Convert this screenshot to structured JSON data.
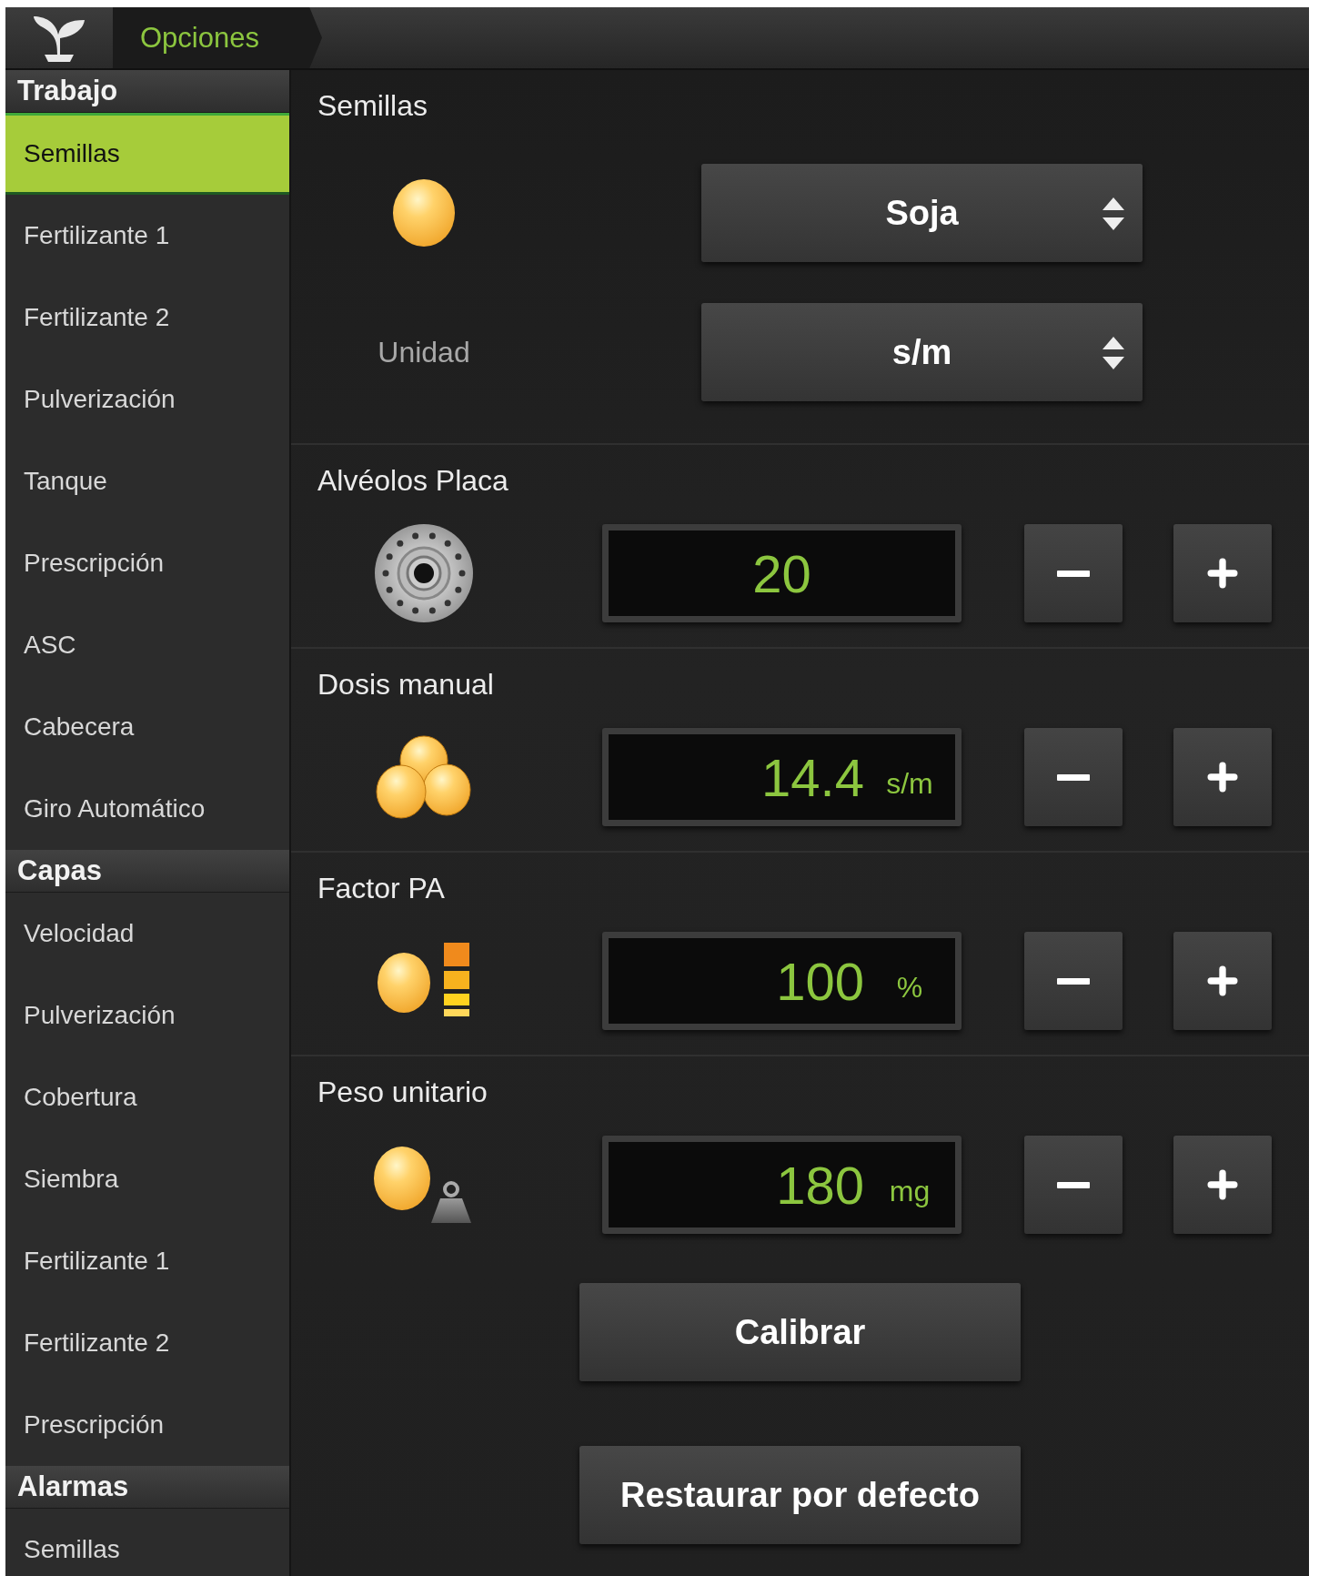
{
  "top_bar": {
    "breadcrumb": "Opciones"
  },
  "sidebar": {
    "groups": [
      {
        "title": "Trabajo",
        "items": [
          {
            "label": "Semillas",
            "selected": true
          },
          {
            "label": "Fertilizante 1",
            "selected": false
          },
          {
            "label": "Fertilizante 2",
            "selected": false
          },
          {
            "label": "Pulverización",
            "selected": false
          },
          {
            "label": "Tanque",
            "selected": false
          },
          {
            "label": "Prescripción",
            "selected": false
          },
          {
            "label": "ASC",
            "selected": false
          },
          {
            "label": "Cabecera",
            "selected": false
          },
          {
            "label": "Giro Automático",
            "selected": false
          }
        ]
      },
      {
        "title": "Capas",
        "items": [
          {
            "label": "Velocidad",
            "selected": false
          },
          {
            "label": "Pulverización",
            "selected": false
          },
          {
            "label": "Cobertura",
            "selected": false
          },
          {
            "label": "Siembra",
            "selected": false
          },
          {
            "label": "Fertilizante 1",
            "selected": false
          },
          {
            "label": "Fertilizante 2",
            "selected": false
          },
          {
            "label": "Prescripción",
            "selected": false
          }
        ]
      },
      {
        "title": "Alarmas",
        "items": [
          {
            "label": "Semillas",
            "selected": false
          }
        ]
      }
    ]
  },
  "main": {
    "sections": [
      {
        "kind": "selects",
        "title": "Semillas",
        "rows": [
          {
            "kind": "icon",
            "value": "Soja"
          },
          {
            "kind": "label",
            "label": "Unidad",
            "value": "s/m"
          }
        ]
      },
      {
        "kind": "stepper",
        "title": "Alvéolos Placa",
        "value": "20"
      },
      {
        "kind": "stepper",
        "title": "Dosis manual",
        "value": "14.4",
        "unit": "s/m"
      },
      {
        "kind": "stepper",
        "title": "Factor PA",
        "value": "100",
        "unit": "%"
      },
      {
        "kind": "stepper",
        "title": "Peso unitario",
        "value": "180",
        "unit": "mg"
      }
    ],
    "buttons": [
      "Calibrar",
      "Restaurar por defecto"
    ]
  }
}
